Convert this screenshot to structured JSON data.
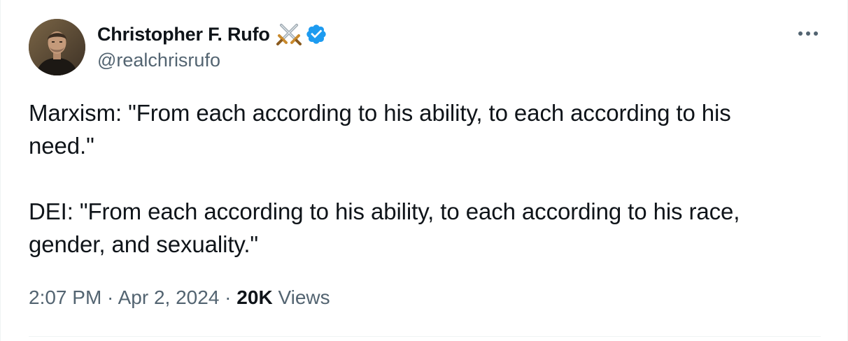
{
  "author": {
    "display_name": "Christopher F. Rufo",
    "handle": "@realchrisrufo",
    "name_emoji_icon": "crossed-swords-icon",
    "badge_icon": "verified-badge-icon",
    "badge_color": "#1d9bf0"
  },
  "menu": {
    "more_icon": "more-horizontal-icon"
  },
  "tweet": {
    "paragraph_1": "Marxism: \"From each according to his ability, to each according to his\nneed.\"",
    "paragraph_2": "DEI: \"From each according to his ability, to each according to his race,\ngender, and sexuality.\""
  },
  "meta": {
    "time": "2:07 PM",
    "separator": " · ",
    "date": "Apr 2, 2024",
    "views_count": "20K",
    "views_label": " Views"
  },
  "colors": {
    "text_primary": "#0f1419",
    "text_secondary": "#536471",
    "divider": "#eff3f4"
  }
}
